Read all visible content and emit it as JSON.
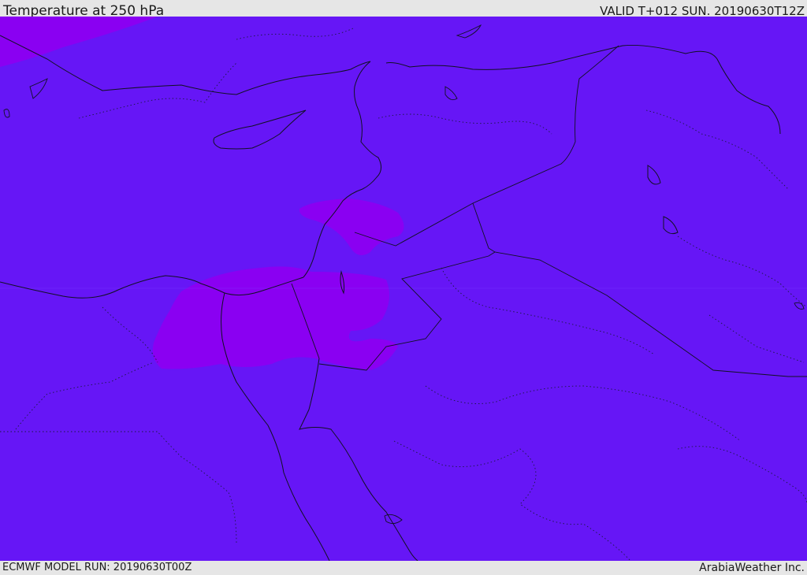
{
  "header": {
    "title": "Temperature at 250 hPa",
    "valid": "VALID T+012 SUN. 20190630T12Z"
  },
  "footer": {
    "model_run": "ECMWF MODEL RUN: 20190630T00Z",
    "credit": "ArabiaWeather Inc."
  },
  "map": {
    "base_color": "#6616f6",
    "warm_color": "#8a00f2"
  }
}
